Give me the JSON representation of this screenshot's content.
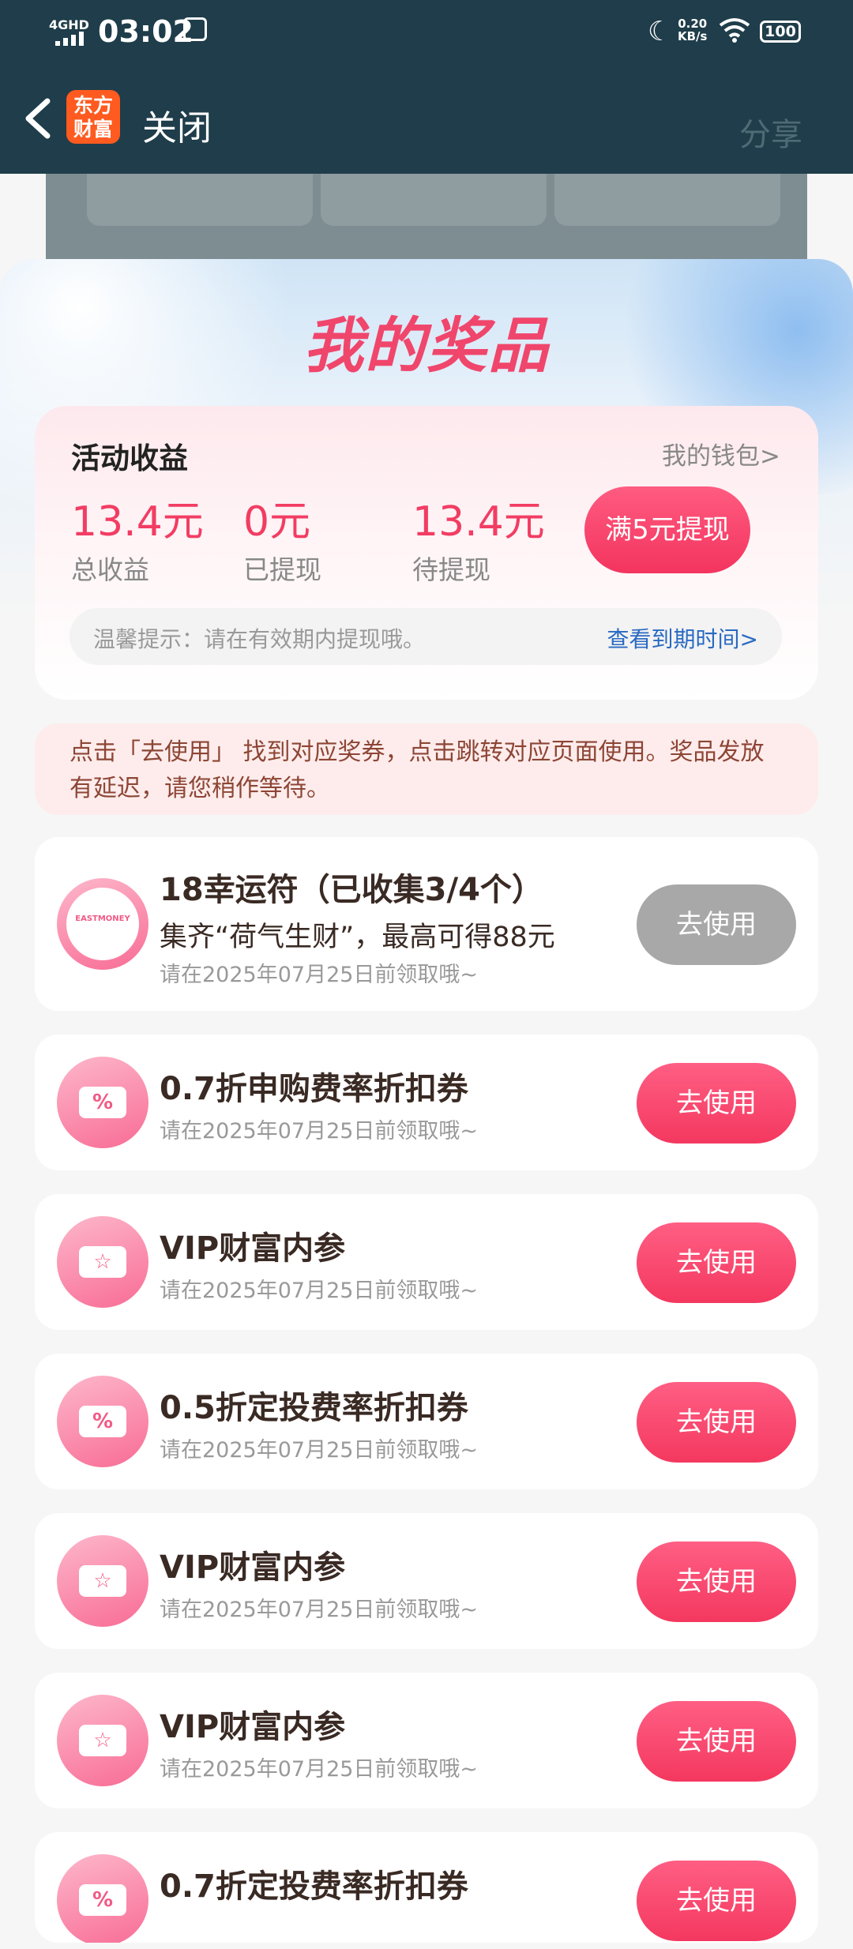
{
  "status_bar": {
    "time": "03:02",
    "network_type": "4GHD",
    "net_speed_value": "0.20",
    "net_speed_unit": "KB/s",
    "battery": "100"
  },
  "nav": {
    "brand_line1": "东方",
    "brand_line2": "财富",
    "close_label": "关闭",
    "share_label": "分享"
  },
  "page_title": "我的奖品",
  "earnings": {
    "title": "活动收益",
    "wallet_link": "我的钱包>",
    "total_value": "13.4元",
    "total_label": "总收益",
    "withdrawn_value": "0元",
    "withdrawn_label": "已提现",
    "pending_value": "13.4元",
    "pending_label": "待提现",
    "withdraw_button": "满5元提现",
    "tip_text": "温馨提示：请在有效期内提现哦。",
    "tip_link": "查看到期时间>"
  },
  "notice": "点击「去使用」 找到对应奖券，点击跳转对应页面使用。奖品发放有延迟，请您稍作等待。",
  "prizes": [
    {
      "title": "18幸运符（已收集3/4个）",
      "subtitle": "集齐“荷气生财”，最高可得88元",
      "expiry": "请在2025年07月25日前领取哦~",
      "button": "去使用",
      "icon": "lucky-charm-icon",
      "icon_text": "EASTMONEY"
    },
    {
      "title": "0.7折申购费率折扣券",
      "expiry": "请在2025年07月25日前领取哦~",
      "button": "去使用",
      "icon": "percent-coupon-icon",
      "icon_text": "%"
    },
    {
      "title": "VIP财富内参",
      "expiry": "请在2025年07月25日前领取哦~",
      "button": "去使用",
      "icon": "star-ticket-icon",
      "icon_text": "☆"
    },
    {
      "title": "0.5折定投费率折扣券",
      "expiry": "请在2025年07月25日前领取哦~",
      "button": "去使用",
      "icon": "percent-coupon-icon",
      "icon_text": "%"
    },
    {
      "title": "VIP财富内参",
      "expiry": "请在2025年07月25日前领取哦~",
      "button": "去使用",
      "icon": "star-ticket-icon",
      "icon_text": "☆"
    },
    {
      "title": "VIP财富内参",
      "expiry": "请在2025年07月25日前领取哦~",
      "button": "去使用",
      "icon": "star-ticket-icon",
      "icon_text": "☆"
    },
    {
      "title": "0.7折定投费率折扣券",
      "button": "去使用",
      "icon": "percent-coupon-icon",
      "icon_text": "%"
    }
  ],
  "colors": {
    "accent": "#f23d63",
    "header_bg": "#1f3d4a",
    "disabled_button": "#a8a8a8"
  }
}
